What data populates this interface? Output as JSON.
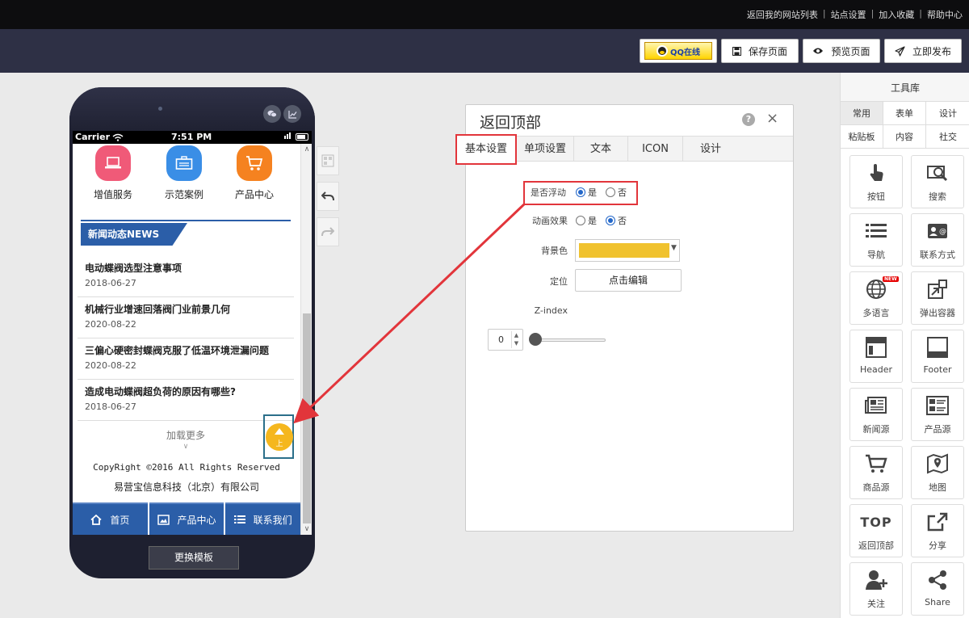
{
  "topbar": {
    "links": [
      "返回我的网站列表",
      "站点设置",
      "加入收藏",
      "帮助中心"
    ]
  },
  "toolbar": {
    "qq_label": "QQ在线",
    "save_label": "保存页面",
    "preview_label": "预览页面",
    "publish_label": "立即发布"
  },
  "phone": {
    "status": {
      "carrier": "Carrier",
      "time": "7:51 PM"
    },
    "categories": [
      {
        "label": "增值服务",
        "color": "#f05a78"
      },
      {
        "label": "示范案例",
        "color": "#3a8ee6"
      },
      {
        "label": "产品中心",
        "color": "#f58220"
      }
    ],
    "news_title": "新闻动态NEWS",
    "news": [
      {
        "title": "电动蝶阀选型注意事项",
        "date": "2018-06-27"
      },
      {
        "title": "机械行业增速回落阀门业前景几何",
        "date": "2020-08-22"
      },
      {
        "title": "三偏心硬密封蝶阀克服了低温环境泄漏问题",
        "date": "2020-08-22"
      },
      {
        "title": "造成电动蝶阀超负荷的原因有哪些?",
        "date": "2018-06-27"
      }
    ],
    "load_more": "加载更多",
    "to_top": "上",
    "copyright": "CopyRight ©2016 All Rights Reserved",
    "company": "易营宝信息科技（北京）有限公司",
    "nav": [
      "首页",
      "产品中心",
      "联系我们"
    ],
    "change_template": "更换模板"
  },
  "dialog": {
    "title": "返回顶部",
    "help": "?",
    "close": "×",
    "tabs": [
      "基本设置",
      "单项设置",
      "文本",
      "ICON",
      "设计"
    ],
    "fields": {
      "float": {
        "label": "是否浮动",
        "options": [
          "是",
          "否"
        ],
        "selected": "是"
      },
      "animation": {
        "label": "动画效果",
        "options": [
          "是",
          "否"
        ],
        "selected": "否"
      },
      "bg_color": {
        "label": "背景色",
        "value": "#f0c22e"
      },
      "position": {
        "label": "定位",
        "button": "点击编辑"
      },
      "zindex": {
        "label": "Z-index",
        "value": "0"
      }
    }
  },
  "library": {
    "title": "工具库",
    "tabs": [
      [
        "常用",
        "表单",
        "设计"
      ],
      [
        "粘贴板",
        "内容",
        "社交"
      ]
    ],
    "tools": [
      {
        "label": "按钮",
        "icon": "hand-pointer-icon"
      },
      {
        "label": "搜索",
        "icon": "search-icon"
      },
      {
        "label": "导航",
        "icon": "list-icon"
      },
      {
        "label": "联系方式",
        "icon": "contact-card-icon"
      },
      {
        "label": "多语言",
        "icon": "globe-icon",
        "badge": "NEW"
      },
      {
        "label": "弹出容器",
        "icon": "popup-icon"
      },
      {
        "label": "Header",
        "icon": "header-icon"
      },
      {
        "label": "Footer",
        "icon": "footer-icon"
      },
      {
        "label": "新闻源",
        "icon": "newspaper-icon"
      },
      {
        "label": "产品源",
        "icon": "product-list-icon"
      },
      {
        "label": "商品源",
        "icon": "cart-icon"
      },
      {
        "label": "地图",
        "icon": "map-icon"
      },
      {
        "label": "返回顶部",
        "icon": "top-icon",
        "text": "TOP"
      },
      {
        "label": "分享",
        "icon": "share-box-icon"
      },
      {
        "label": "关注",
        "icon": "user-add-icon"
      },
      {
        "label": "Share",
        "icon": "share-nodes-icon"
      }
    ]
  }
}
